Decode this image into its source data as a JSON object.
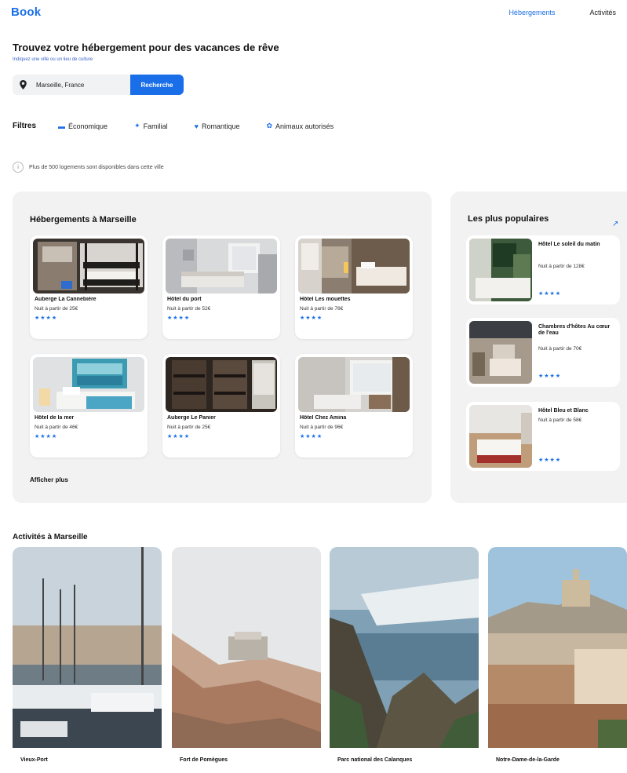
{
  "header": {
    "logo": "Book",
    "nav": [
      {
        "label": "Hébergements",
        "active": true
      },
      {
        "label": "Activités",
        "active": false
      }
    ]
  },
  "hero": {
    "title": "Trouvez votre hébergement pour des vacances de rêve",
    "subtitle": "Indiquez une ville ou un lieu de culture"
  },
  "search": {
    "value": "Marseille, France",
    "button_label": "Recherche"
  },
  "filters": {
    "label": "Filtres",
    "items": [
      {
        "label": "Économique",
        "icon": "money-icon"
      },
      {
        "label": "Familial",
        "icon": "family-icon"
      },
      {
        "label": "Romantique",
        "icon": "heart-icon"
      },
      {
        "label": "Animaux autorisés",
        "icon": "paw-icon"
      }
    ]
  },
  "info": {
    "text": "Plus de 500 logements sont disponibles dans cette ville"
  },
  "listings": {
    "title": "Hébergements à Marseille",
    "more_label": "Afficher plus",
    "items": [
      {
        "name": "Auberge La Cannebière",
        "price": "Nuit à partir de 25€",
        "stars": "★★★★"
      },
      {
        "name": "Hôtel du port",
        "price": "Nuit à partir de 52€",
        "stars": "★★★★"
      },
      {
        "name": "Hôtel Les mouettes",
        "price": "Nuit à partir de 76€",
        "stars": "★★★★"
      },
      {
        "name": "Hôtel de la mer",
        "price": "Nuit à partir de 46€",
        "stars": "★★★★"
      },
      {
        "name": "Auberge Le Panier",
        "price": "Nuit à partir de 25€",
        "stars": "★★★★"
      },
      {
        "name": "Hôtel Chez Amina",
        "price": "Nuit à partir de 96€",
        "stars": "★★★★"
      }
    ]
  },
  "popular": {
    "title": "Les plus populaires",
    "icon": "trend-icon",
    "items": [
      {
        "name": "Hôtel Le soleil du matin",
        "price": "Nuit à partir de 128€",
        "stars": "★★★★"
      },
      {
        "name": "Chambres d'hôtes Au cœur de l'eau",
        "price": "Nuit à partir de 70€",
        "stars": "★★★★"
      },
      {
        "name": "Hôtel Bleu et Blanc",
        "price": "Nuit à partir de 58€",
        "stars": "★★★★"
      }
    ]
  },
  "activities": {
    "title": "Activités à Marseille",
    "items": [
      {
        "name": "Vieux-Port"
      },
      {
        "name": "Fort de Pomègues"
      },
      {
        "name": "Parc national des Calanques"
      },
      {
        "name": "Notre-Dame-de-la-Garde"
      }
    ]
  }
}
